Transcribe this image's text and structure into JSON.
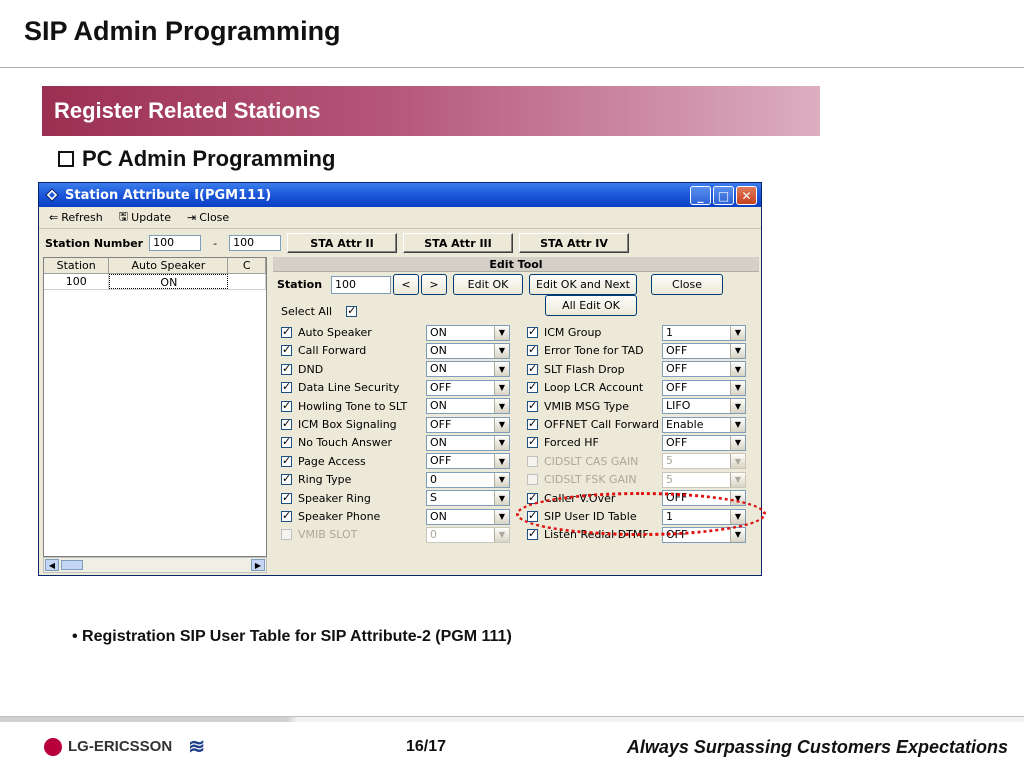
{
  "slide": {
    "title": "SIP Admin Programming",
    "banner": "Register Related Stations",
    "subhead": "PC Admin Programming",
    "bullet": "• Registration SIP User Table for SIP Attribute-2 (PGM 111)",
    "footer_page": "16/17",
    "footer_tagline": "Always Surpassing Customers Expectations",
    "footer_logo": "LG-ERICSSON"
  },
  "window": {
    "title": "Station Attribute I(PGM111)",
    "toolbar": {
      "refresh": "Refresh",
      "update": "Update",
      "close": "Close"
    },
    "station_number_label": "Station Number",
    "station_from": "100",
    "station_dash": "-",
    "station_to": "100",
    "tab_buttons": [
      "STA Attr II",
      "STA Attr III",
      "STA Attr IV"
    ],
    "grid": {
      "headers": [
        "Station",
        "Auto Speaker",
        "C"
      ],
      "rows": [
        [
          "100",
          "ON",
          ""
        ]
      ]
    },
    "edit_tool": {
      "header": "Edit Tool",
      "station_label": "Station",
      "station_value": "100",
      "prev": "<",
      "next": ">",
      "edit_ok": "Edit OK",
      "edit_ok_next": "Edit OK and Next",
      "close": "Close",
      "all_edit_ok": "All Edit OK",
      "select_all": "Select All"
    },
    "left_fields": [
      {
        "label": "Auto Speaker",
        "value": "ON",
        "checked": true,
        "disabled": false
      },
      {
        "label": "Call Forward",
        "value": "ON",
        "checked": true,
        "disabled": false
      },
      {
        "label": "DND",
        "value": "ON",
        "checked": true,
        "disabled": false
      },
      {
        "label": "Data Line Security",
        "value": "OFF",
        "checked": true,
        "disabled": false
      },
      {
        "label": "Howling Tone to SLT",
        "value": "ON",
        "checked": true,
        "disabled": false
      },
      {
        "label": "ICM Box Signaling",
        "value": "OFF",
        "checked": true,
        "disabled": false
      },
      {
        "label": "No Touch Answer",
        "value": "ON",
        "checked": true,
        "disabled": false
      },
      {
        "label": "Page Access",
        "value": "OFF",
        "checked": true,
        "disabled": false
      },
      {
        "label": "Ring Type",
        "value": "0",
        "checked": true,
        "disabled": false
      },
      {
        "label": "Speaker Ring",
        "value": "S",
        "checked": true,
        "disabled": false
      },
      {
        "label": "Speaker Phone",
        "value": "ON",
        "checked": true,
        "disabled": false
      },
      {
        "label": "VMIB SLOT",
        "value": "0",
        "checked": false,
        "disabled": true
      }
    ],
    "right_fields": [
      {
        "label": "ICM Group",
        "value": "1",
        "checked": true,
        "disabled": false
      },
      {
        "label": "Error Tone for TAD",
        "value": "OFF",
        "checked": true,
        "disabled": false
      },
      {
        "label": "SLT Flash Drop",
        "value": "OFF",
        "checked": true,
        "disabled": false
      },
      {
        "label": "Loop LCR Account",
        "value": "OFF",
        "checked": true,
        "disabled": false
      },
      {
        "label": "VMIB MSG Type",
        "value": "LIFO",
        "checked": true,
        "disabled": false
      },
      {
        "label": "OFFNET Call Forward",
        "value": "Enable",
        "checked": true,
        "disabled": false
      },
      {
        "label": "Forced HF",
        "value": "OFF",
        "checked": true,
        "disabled": false
      },
      {
        "label": "CIDSLT CAS GAIN",
        "value": "5",
        "checked": false,
        "disabled": true
      },
      {
        "label": "CIDSLT FSK GAIN",
        "value": "5",
        "checked": false,
        "disabled": true
      },
      {
        "label": "Caller V.Over",
        "value": "OFF",
        "checked": true,
        "disabled": false
      },
      {
        "label": "SIP User ID Table",
        "value": "1",
        "checked": true,
        "disabled": false
      },
      {
        "label": "Listen Redial DTMF",
        "value": "OFF",
        "checked": true,
        "disabled": false
      }
    ]
  },
  "colors": {
    "banner": "#9b2f52",
    "titlebar": "#1b56d8",
    "highlight": "#e01010"
  }
}
